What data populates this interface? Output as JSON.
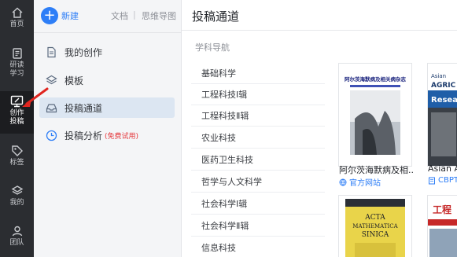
{
  "rail": {
    "items": [
      {
        "label": "首页",
        "icon": "home-icon"
      },
      {
        "label": "研读\n学习",
        "icon": "study-icon"
      },
      {
        "label": "创作\n投稿",
        "icon": "create-icon",
        "active": true
      },
      {
        "label": "标签",
        "icon": "tag-icon"
      },
      {
        "label": "我的",
        "icon": "layers-icon"
      },
      {
        "label": "团队",
        "icon": "team-icon"
      }
    ]
  },
  "toolbar": {
    "new_label": "新建",
    "doc_label": "文档",
    "separator": "|",
    "mindmap_label": "思维导图"
  },
  "menu": {
    "items": [
      {
        "label": "我的创作",
        "icon": "doc-icon"
      },
      {
        "label": "模板",
        "icon": "layers-icon"
      },
      {
        "label": "投稿通道",
        "icon": "tray-icon",
        "active": true
      },
      {
        "label": "投稿分析",
        "icon": "clock-icon",
        "tag": "(免费试用)"
      }
    ]
  },
  "content": {
    "title": "投稿通道",
    "nav_heading": "学科导航",
    "categories": [
      "基础科学",
      "工程科技Ⅰ辑",
      "工程科技Ⅱ辑",
      "农业科技",
      "医药卫生科技",
      "哲学与人文科学",
      "社会科学Ⅰ辑",
      "社会科学Ⅱ辑",
      "信息科技"
    ],
    "journals": [
      {
        "name": "阿尔茨海默病及相...",
        "link": "官方网站",
        "cover_title": "阿尔茨海默病及相关病杂志"
      },
      {
        "name": "Asian A",
        "link": "CBPT",
        "cover_title": "Asian AGRIC Resea"
      }
    ],
    "journals_row2": [
      {
        "cover_title": "ACTA MATHEMATICA SINICA"
      },
      {
        "cover_title": "工程"
      }
    ]
  },
  "colors": {
    "accent": "#2d7ef7",
    "rail_bg": "#2b2d31",
    "active_menu_bg": "#dce6f2",
    "annotation_red": "#e0251f",
    "free_tag": "#e5373b"
  }
}
